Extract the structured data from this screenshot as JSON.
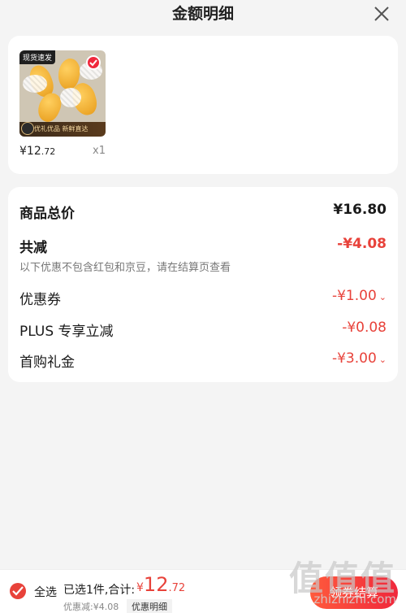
{
  "header": {
    "title": "金额明细"
  },
  "product": {
    "tag_top": "现货速发",
    "tag_bottom": "优礼优品 新鲜直达",
    "badge_text": "新鲜直达",
    "currency": "¥",
    "price_int": "12",
    "price_dec": ".72",
    "qty": "x1"
  },
  "breakdown": {
    "total_label": "商品总价",
    "total_value": "¥16.80",
    "reduce_label": "共减",
    "reduce_value": "-¥4.08",
    "note": "以下优惠不包含红包和京豆，请在结算页查看",
    "items": [
      {
        "label": "优惠券",
        "value": "-¥1.00"
      },
      {
        "label": "PLUS 专享立减",
        "value": "-¥0.08"
      },
      {
        "label": "首购礼金",
        "value": "-¥3.00"
      }
    ]
  },
  "bottom_bar": {
    "select_all": "全选",
    "summary": "已选1件,合计:",
    "currency": "¥",
    "total_int": "12",
    "total_dec": ".72",
    "discount": "优惠减:¥4.08",
    "detail_link": "优惠明细",
    "checkout": "领券结算"
  },
  "watermark": {
    "logo": "值值值",
    "site": "zhizhizhi.com"
  },
  "colors": {
    "accent": "#e8423a",
    "checkout": "#f0283c"
  }
}
